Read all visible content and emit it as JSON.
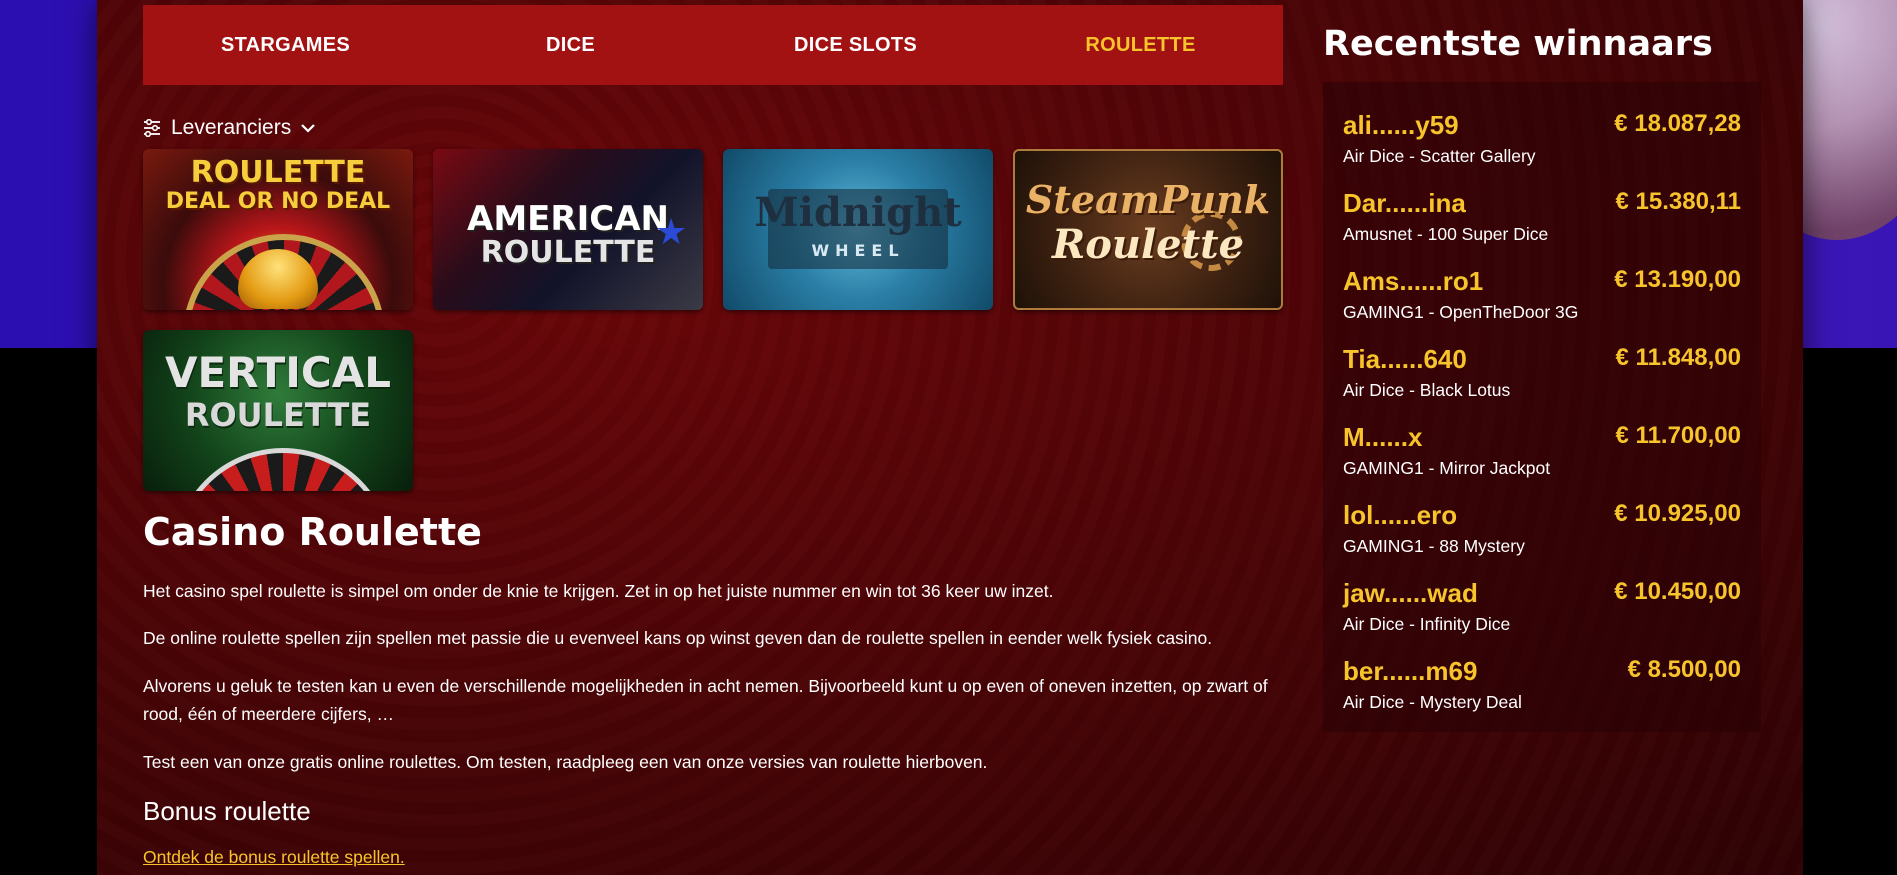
{
  "nav": {
    "tabs": [
      {
        "label": "STARGAMES"
      },
      {
        "label": "DICE"
      },
      {
        "label": "DICE SLOTS"
      },
      {
        "label": "ROULETTE"
      }
    ],
    "active_tab": "ROULETTE"
  },
  "filter": {
    "label": "Leveranciers",
    "icon": "sliders-icon",
    "caret_icon": "chevron-down-icon"
  },
  "games": [
    {
      "title_line1": "ROULETTE",
      "title_line2": "DEAL OR NO DEAL"
    },
    {
      "title_line1": "AMERICAN",
      "title_line2": "ROULETTE"
    },
    {
      "title_line1": "Midnight",
      "title_line2": "WHEEL"
    },
    {
      "title_line1": "SteamPunk",
      "title_line2": "Roulette"
    },
    {
      "title_line1": "VERTICAL",
      "title_line2": "ROULETTE"
    }
  ],
  "content": {
    "heading": "Casino Roulette",
    "p1": "Het casino spel roulette is simpel om onder de knie te krijgen. Zet in op het juiste nummer en win tot 36 keer uw inzet.",
    "p2": "De online roulette spellen zijn spellen met passie die u evenveel kans op winst geven dan de roulette spellen in eender welk fysiek casino.",
    "p3": "Alvorens u geluk te testen kan u even de verschillende mogelijkheden in acht nemen. Bijvoorbeeld kunt u op even of oneven inzetten, op zwart of rood, één of meerdere cijfers, …",
    "p4": "Test een van onze gratis online roulettes. Om testen, raadpleeg een van onze versies van roulette hierboven.",
    "subheading": "Bonus roulette",
    "bonus_link": "Ontdek de bonus roulette spellen."
  },
  "winners": {
    "title": "Recentste winnaars",
    "items": [
      {
        "name": "ali......y59",
        "amount": "€ 18.087,28",
        "game": "Air Dice - Scatter Gallery"
      },
      {
        "name": "Dar......ina",
        "amount": "€ 15.380,11",
        "game": "Amusnet - 100 Super Dice"
      },
      {
        "name": "Ams......ro1",
        "amount": "€ 13.190,00",
        "game": "GAMING1 - OpenTheDoor 3G"
      },
      {
        "name": "Tia......640",
        "amount": "€ 11.848,00",
        "game": "Air Dice - Black Lotus"
      },
      {
        "name": "M......x",
        "amount": "€ 11.700,00",
        "game": "GAMING1 - Mirror Jackpot"
      },
      {
        "name": "lol......ero",
        "amount": "€ 10.925,00",
        "game": "GAMING1 - 88 Mystery"
      },
      {
        "name": "jaw......wad",
        "amount": "€ 10.450,00",
        "game": "Air Dice - Infinity Dice"
      },
      {
        "name": "ber......m69",
        "amount": "€ 8.500,00",
        "game": "Air Dice - Mystery Deal"
      }
    ]
  },
  "colors": {
    "nav_bg": "#a31213",
    "accent": "#f7c52b",
    "page_bg": "#4a0406"
  }
}
